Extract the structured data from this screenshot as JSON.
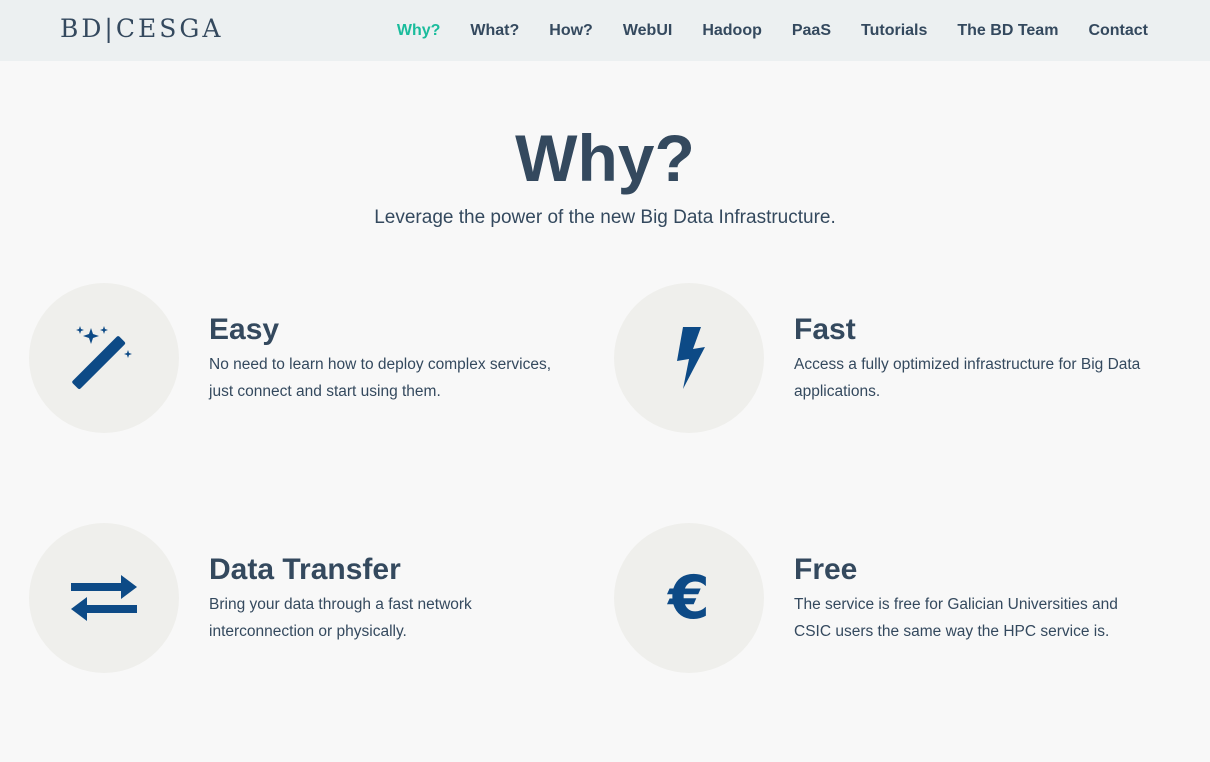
{
  "brand": "BD|CESGA",
  "nav": [
    {
      "label": "Why?",
      "active": true
    },
    {
      "label": "What?"
    },
    {
      "label": "How?"
    },
    {
      "label": "WebUI"
    },
    {
      "label": "Hadoop"
    },
    {
      "label": "PaaS"
    },
    {
      "label": "Tutorials"
    },
    {
      "label": "The BD Team"
    },
    {
      "label": "Contact"
    }
  ],
  "hero": {
    "title": "Why?",
    "subtitle": "Leverage the power of the new Big Data Infrastructure."
  },
  "features": [
    {
      "icon": "magic-wand-icon",
      "title": "Easy",
      "text": "No need to learn how to deploy complex services, just connect and start using them."
    },
    {
      "icon": "lightning-bolt-icon",
      "title": "Fast",
      "text": "Access a fully optimized infrastructure for Big Data applications."
    },
    {
      "icon": "transfer-arrows-icon",
      "title": "Data Transfer",
      "text": "Bring your data through a fast network interconnection or physically."
    },
    {
      "icon": "euro-icon",
      "euro_glyph": "€",
      "title": "Free",
      "text": "The service is free for Galician Universities and CSIC users the same way the HPC service is."
    }
  ],
  "colors": {
    "text": "#34495e",
    "accent": "#1abc9c",
    "icon": "#0d4a86",
    "navbar_bg": "#ecf0f1",
    "circle_bg": "#efefec",
    "page_bg": "#f8f8f8"
  }
}
